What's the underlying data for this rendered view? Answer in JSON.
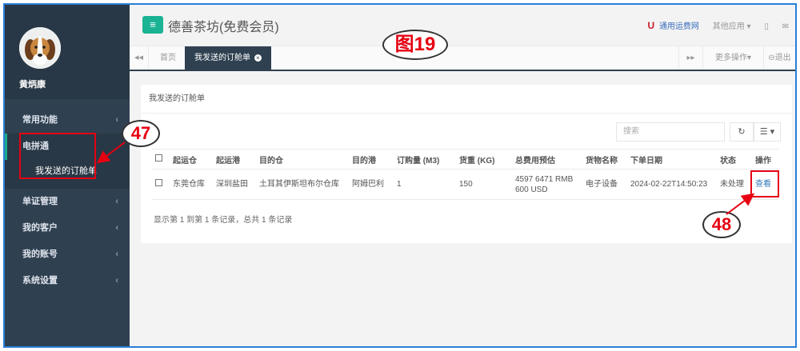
{
  "app": {
    "title": "德善茶坊(免费会员)",
    "menu_icon": "≡"
  },
  "user": {
    "name": "黄炳康"
  },
  "sidebar": {
    "items": [
      {
        "label": "常用功能",
        "arrow": "‹"
      },
      {
        "label": "电拼通",
        "arrow": ""
      },
      {
        "label": "我发送的订舱单"
      },
      {
        "label": "单证管理",
        "arrow": "‹"
      },
      {
        "label": "我的客户",
        "arrow": "‹"
      },
      {
        "label": "我的账号",
        "arrow": "‹"
      },
      {
        "label": "系统设置",
        "arrow": "‹"
      }
    ]
  },
  "topbar": {
    "logo_mark": "U",
    "link1": "通用运费网",
    "link2": "其他应用 ▾",
    "icon_phone": "▯",
    "icon_mail": "✉"
  },
  "tabs": {
    "left_nav": "◂◂",
    "home": "首页",
    "active": "我发送的订舱单",
    "close_icon": "×",
    "right_nav": "▸▸",
    "more_ops": "更多操作▾",
    "logout": "⊖退出"
  },
  "panel": {
    "heading": "我发送的订舱单",
    "search_placeholder": "搜索",
    "refresh_icon": "↻",
    "columns_icon": "☰ ▾"
  },
  "table": {
    "headers": [
      "",
      "起运仓",
      "起运港",
      "目的仓",
      "目的港",
      "订购量 (M3)",
      "货重 (KG)",
      "总费用预估",
      "货物名称",
      "下单日期",
      "状态",
      "操作"
    ],
    "rows": [
      {
        "origin_warehouse": "东莞仓库",
        "origin_port": "深圳盐田",
        "dest_warehouse": "土耳其伊斯坦布尔仓库",
        "dest_port": "阿姆巴利",
        "volume": "1",
        "weight": "150",
        "total_line1": "4597 6471 RMB",
        "total_line2": "600 USD",
        "goods": "电子设备",
        "date": "2024-02-22T14:50:23",
        "status": "未处理",
        "action": "查看"
      }
    ]
  },
  "pagination_text": "显示第 1 到第 1 条记录，总共 1 条记录",
  "annotations": {
    "figure_label": "图19",
    "label_47": "47",
    "label_48": "48",
    "color": "#e60012"
  }
}
